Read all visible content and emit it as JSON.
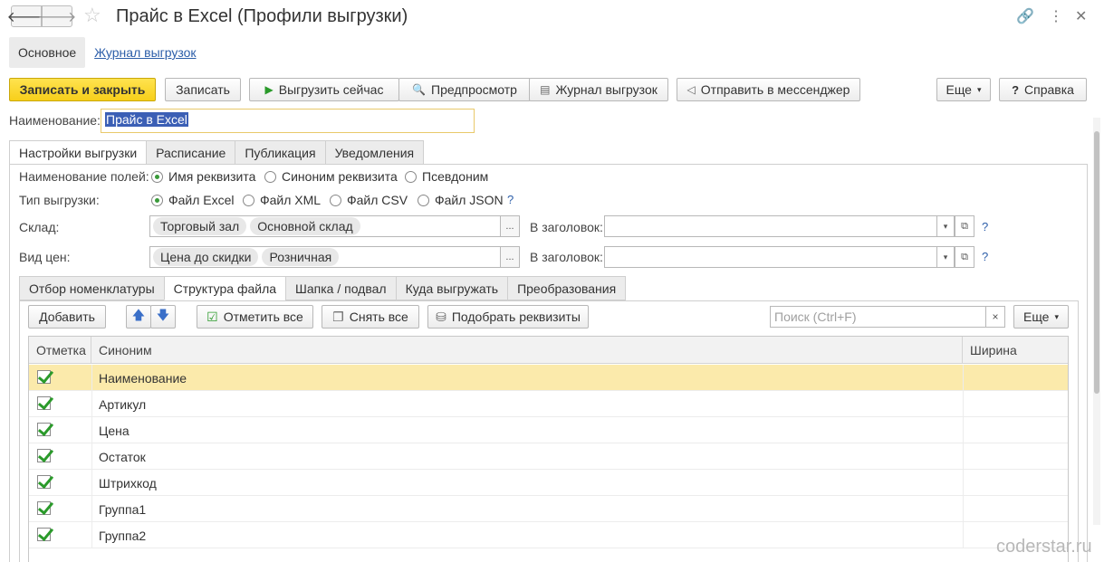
{
  "window": {
    "title": "Прайс в Excel (Профили выгрузки)",
    "back_icon": "🡐",
    "forward_icon": "🡒",
    "star_icon": "☆",
    "link_icon": "🔗",
    "more_icon": "⋮",
    "close_icon": "✕"
  },
  "sections": {
    "main": "Основное",
    "log": "Журнал выгрузок"
  },
  "toolbar": {
    "save_close": "Записать и закрыть",
    "save": "Записать",
    "export_now": "Выгрузить сейчас",
    "preview": "Предпросмотр",
    "log": "Журнал выгрузок",
    "send_messenger": "Отправить в мессенджер",
    "more": "Еще",
    "help": "Справка",
    "play_icon": "▶",
    "preview_icon": "🔍",
    "log_icon": "▤",
    "send_icon": "◁",
    "dropdown_icon": "▾",
    "help_icon": "?"
  },
  "name_field": {
    "label": "Наименование:",
    "value": "Прайс в Excel"
  },
  "main_tabs": [
    "Настройки выгрузки",
    "Расписание",
    "Публикация",
    "Уведомления"
  ],
  "settings": {
    "field_names_label": "Наименование полей:",
    "field_names_options": [
      "Имя реквизита",
      "Синоним реквизита",
      "Псевдоним"
    ],
    "field_names_selected": 0,
    "export_type_label": "Тип выгрузки:",
    "export_type_options": [
      "Файл Excel",
      "Файл XML",
      "Файл CSV",
      "Файл JSON"
    ],
    "export_type_selected": 0,
    "help_mark": "?",
    "warehouse_label": "Склад:",
    "warehouse_values": [
      "Торговый зал",
      "Основной склад"
    ],
    "price_type_label": "Вид цен:",
    "price_type_values": [
      "Цена до скидки",
      "Розничная"
    ],
    "header_label": "В заголовок:",
    "ellipsis": "...",
    "open_icon": "⧉"
  },
  "sub_tabs": [
    "Отбор номенклатуры",
    "Структура файла",
    "Шапка / подвал",
    "Куда выгружать",
    "Преобразования"
  ],
  "sub_tab_active": 1,
  "structure_toolbar": {
    "add": "Добавить",
    "mark_all": "Отметить все",
    "unmark_all": "Снять все",
    "pick_attrs": "Подобрать реквизиты",
    "more": "Еще",
    "search_placeholder": "Поиск (Ctrl+F)",
    "up_icon": "🡅",
    "down_icon": "🡇",
    "mark_icon": "☑",
    "unmark_icon": "❐",
    "pick_icon": "⛁",
    "clear_icon": "×"
  },
  "grid": {
    "columns": [
      "Отметка",
      "Синоним",
      "Ширина"
    ],
    "rows": [
      {
        "checked": true,
        "synonym": "Наименование"
      },
      {
        "checked": true,
        "synonym": "Артикул"
      },
      {
        "checked": true,
        "synonym": "Цена"
      },
      {
        "checked": true,
        "synonym": "Остаток"
      },
      {
        "checked": true,
        "synonym": "Штрихкод"
      },
      {
        "checked": true,
        "synonym": "Группа1"
      },
      {
        "checked": true,
        "synonym": "Группа2"
      }
    ],
    "selected_row": 0
  },
  "watermark": "coderstar.ru"
}
